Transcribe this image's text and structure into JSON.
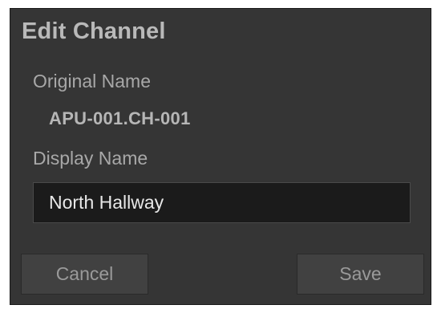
{
  "dialog": {
    "title": "Edit Channel",
    "original_name_label": "Original Name",
    "original_name_value": "APU-001.CH-001",
    "display_name_label": "Display Name",
    "display_name_value": "North Hallway",
    "cancel_label": "Cancel",
    "save_label": "Save"
  }
}
